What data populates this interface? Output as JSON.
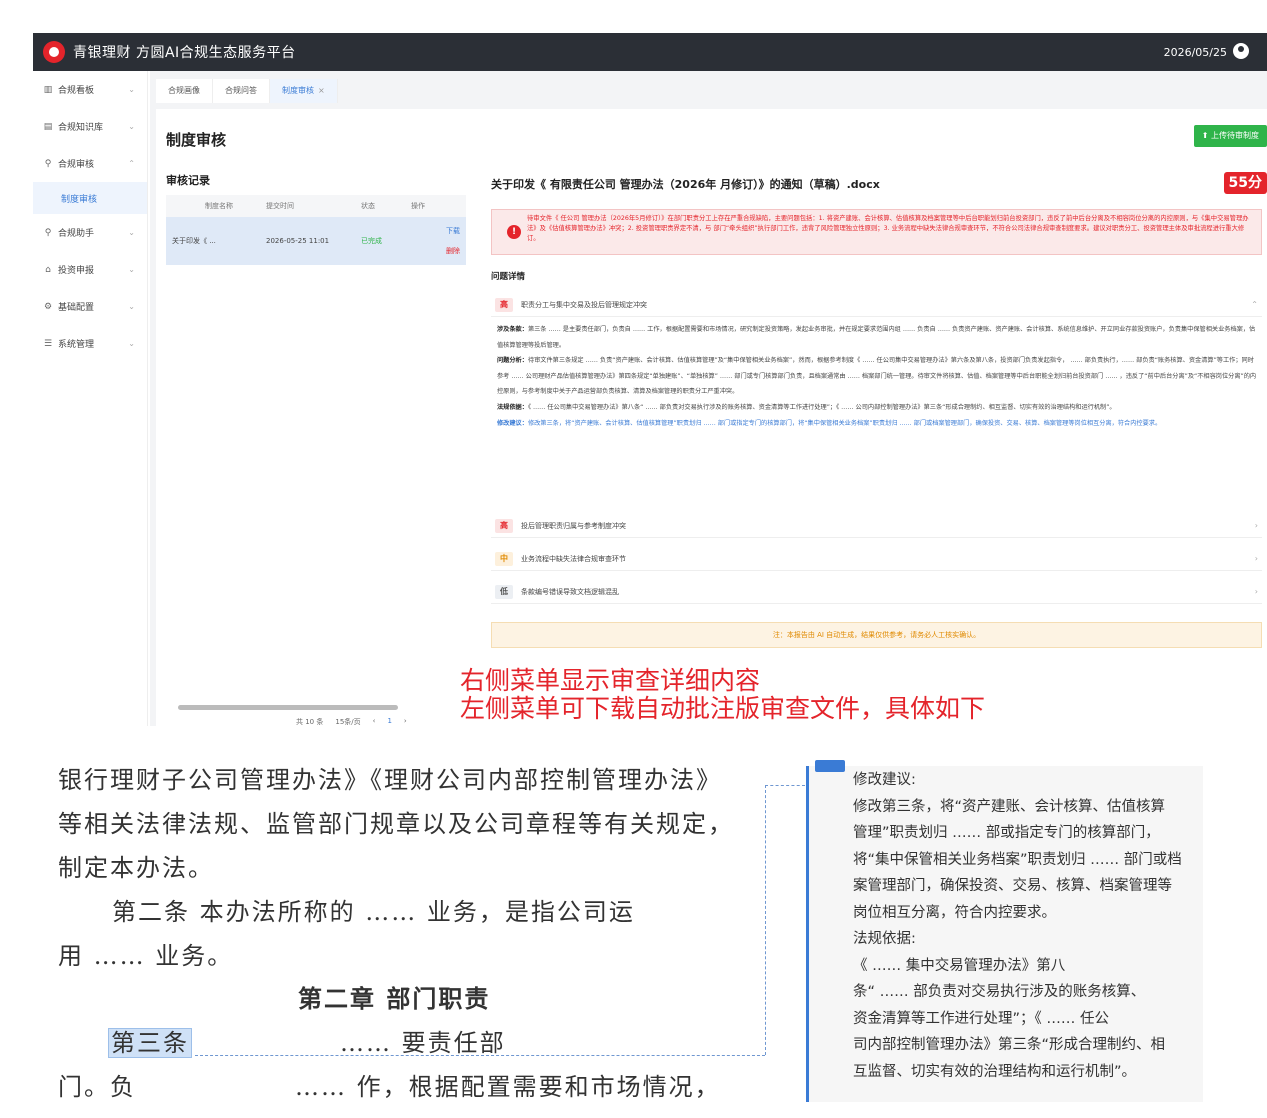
{
  "app": {
    "title": "青银理财 方圆AI合规生态服务平台",
    "date": "2026/05/25"
  },
  "sidebar": {
    "items": [
      {
        "label": "合规看板",
        "icon": "bar-chart-icon"
      },
      {
        "label": "合规知识库",
        "icon": "library-icon"
      },
      {
        "label": "合规审核",
        "icon": "location-pin-icon"
      },
      {
        "label": "制度审核",
        "icon": ""
      },
      {
        "label": "合规助手",
        "icon": "location-pin-icon"
      },
      {
        "label": "投资申报",
        "icon": "home-icon"
      },
      {
        "label": "基础配置",
        "icon": "gear-icon"
      },
      {
        "label": "系统管理",
        "icon": "list-icon"
      }
    ]
  },
  "tabs": [
    {
      "label": "合规画像"
    },
    {
      "label": "合规问答"
    },
    {
      "label": "制度审核",
      "close": "×"
    }
  ],
  "page": {
    "title": "制度审核",
    "upload_label": "上传待审制度"
  },
  "review": {
    "title": "审核记录",
    "columns": [
      "制度名称",
      "提交时间",
      "状态",
      "操作"
    ],
    "row": {
      "name": "关于印发《 ...",
      "time": "2026-05-25 11:01",
      "status": "已完成",
      "download": "下载",
      "delete": "删除"
    },
    "pager": {
      "total": "共 10 条",
      "size": "15条/页",
      "prev": "‹",
      "page": "1",
      "next": "›"
    }
  },
  "detail": {
    "doc_title": "关于印发《 有限责任公司 管理办法（2026年 月修订）》的通知（草稿）.docx",
    "score": "55分",
    "alert": "待审文件《 任公司 管理办法（2026年5月修订）》在部门职责分工上存在严重合规缺陷，主要问题包括：1. 将资产建账、会计核算、估值核算及档案管理等中后台职能划归前台投资部门，违反了前中后台分离及不相容岗位分离的内控原则，与《集中交易管理办法》及《估值核算管理办法》冲突；2. 投资管理职责界定不清，与 部门“牵头组织”执行部门工作，违背了风险管理独立性原则；3. 业务流程中缺失法律合规审查环节，不符合公司法律合规审查制度要求。建议对职责分工、投资管理主体及审批流程进行重大修订。",
    "issues_header": "问题详情",
    "issues": [
      {
        "level": "高",
        "title": "职责分工与集中交易及投后管理规定冲突"
      },
      {
        "level": "高",
        "title": "投后管理职责归属与参考制度冲突"
      },
      {
        "level": "中",
        "title": "业务流程中缺失法律合规审查环节"
      },
      {
        "level": "低",
        "title": "条款编号错误导致文档逻辑混乱"
      }
    ],
    "issue_detail": {
      "clause_label": "涉及条款：",
      "clause": "第三条 …… 是主要责任部门，负责自 …… 工作，根据配置需要和市场情况，研究制定投资策略，发起业务审批，并在规定要求范围内组 …… 负责自 …… 负责资产建账、资产建账、会计核算、系统信息维护、开立同业存款投资账户，负责集中保管相关业务档案，估值核算管理等投后管理。",
      "analysis_label": "问题分析：",
      "analysis": "待审文件第三条规定 …… 负责“资产建账、会计核算、估值核算管理”及“集中保管相关业务档案”，然而，根据参考制度《 …… 任公司集中交易管理办法》第六条及第八条，投资部门负责发起指令， …… 部负责执行，…… 部负责“账务核算、资金清算”等工作；同时参考 …… 公司理财产品估值核算管理办法》第四条规定“单独建账”、“单独核算” …… 部门或专门核算部门负责，且档案通常由 …… 档案部门统一管理。待审文件将核算、估值、档案管理等中后台职能全划归前台投资部门 …… ，违反了“前中后台分离”及“不相容岗位分离”的内控原则，与参考制度中关于产品运营部负责核算、清算及档案管理的职责分工严重冲突。",
      "basis_label": "法规依据：",
      "basis": "《 …… 任公司集中交易管理办法》第八条“ …… 部负责对交易执行涉及的账务核算、资金清算等工作进行处理”；《 …… 公司内部控制管理办法》第三条“形成合理制约、相互监督、切实有效的治理结构和运行机制”。",
      "suggest_label": "修改建议：",
      "suggest": "修改第三条，将“资产建账、会计核算、估值核算管理”职责划归 …… 部门或指定专门的核算部门，将“集中保管相关业务档案”职责划归 …… 部门或档案管理部门，确保投资、交易、核算、档案管理等岗位相互分离，符合内控要求。"
    },
    "note": "注：本报告由 AI 自动生成，结果仅供参考，请务必人工核实确认。"
  },
  "caption": {
    "line1": "右侧菜单显示审查详细内容",
    "line2": "左侧菜单可下载自动批注版审查文件，具体如下"
  },
  "doc_excerpt": {
    "lines": [
      "银行理财子公司管理办法》《理财公司内部控制管理办法》",
      "等相关法律法规、监管部门规章以及公司章程等有关规定，",
      "制定本办法。",
      "第二条  本办法所称的 …… 业务，是指公司运",
      "用 …… 业务。",
      "第二章    部门职责",
      "第三条",
      " …… 要责任部",
      "门。负",
      " …… 作，根据配置需要和市场情况，"
    ]
  },
  "comment": {
    "lines": [
      "修改建议:",
      "修改第三条，将“资产建账、会计核算、估值核算",
      "管理”职责划归 …… 部或指定专门的核算部门，",
      "将“集中保管相关业务档案”职责划归 …… 部门或档",
      "案管理部门，确保投资、交易、核算、档案管理等",
      "岗位相互分离，符合内控要求。",
      "法规依据:",
      "《 …… 集中交易管理办法》第八",
      "条“ …… 部负责对交易执行涉及的账务核算、",
      "资金清算等工作进行处理”；《 …… 任公",
      "司内部控制管理办法》第三条“形成合理制约、相",
      "互监督、切实有效的治理结构和运行机制”。"
    ]
  }
}
